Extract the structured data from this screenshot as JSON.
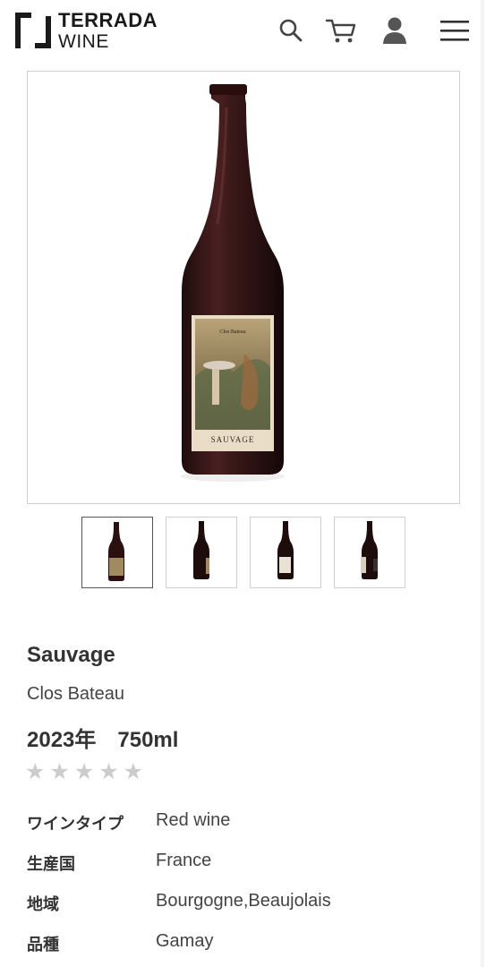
{
  "header": {
    "logo_line1": "TERRADA",
    "logo_line2": "WINE",
    "icons": [
      "search-icon",
      "cart-icon",
      "user-icon",
      "menu-icon"
    ]
  },
  "gallery": {
    "main_label_top": "Clos Bateau",
    "main_label_bottom": "SAUVAGE",
    "thumbnail_count": 4,
    "active_index": 0
  },
  "product": {
    "name": "Sauvage",
    "producer": "Clos Bateau",
    "vintage_size": "2023年　750ml",
    "rating_stars": "★★★★★",
    "rating_value": 0
  },
  "specs": [
    {
      "label": "ワインタイプ",
      "value": "Red wine"
    },
    {
      "label": "生産国",
      "value": "France"
    },
    {
      "label": "地域",
      "value": "Bourgogne,Beaujolais"
    },
    {
      "label": "品種",
      "value": "Gamay"
    }
  ],
  "colors": {
    "bottle": "#3a1818",
    "label_bg": "#e9ddc8",
    "star_inactive": "#cccccc",
    "text": "#333333"
  }
}
